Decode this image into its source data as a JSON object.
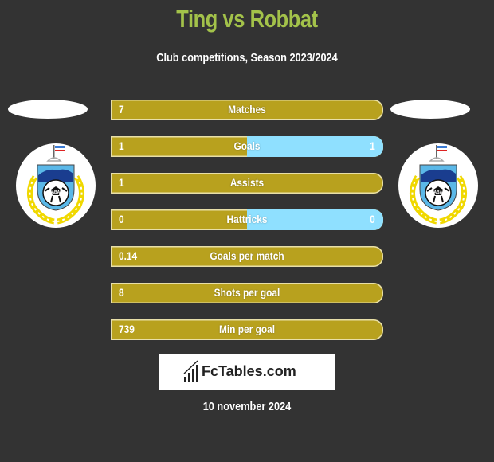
{
  "header": {
    "title": "Ting vs Robbat",
    "subtitle": "Club competitions, Season 2023/2024"
  },
  "colors": {
    "background": "#333333",
    "title": "#a3c24a",
    "left_bar": "#b8a11e",
    "right_bar": "#8fe0ff"
  },
  "players": {
    "left": {
      "name": "Ting",
      "club_badge": "sabah-fa-badge-icon"
    },
    "right": {
      "name": "Robbat",
      "club_badge": "sabah-fa-badge-icon"
    }
  },
  "stats": [
    {
      "label": "Matches",
      "left": "7",
      "right": "",
      "right_share": 0
    },
    {
      "label": "Goals",
      "left": "1",
      "right": "1",
      "right_share": 0.5
    },
    {
      "label": "Assists",
      "left": "1",
      "right": "",
      "right_share": 0
    },
    {
      "label": "Hattricks",
      "left": "0",
      "right": "0",
      "right_share": 0.5
    },
    {
      "label": "Goals per match",
      "left": "0.14",
      "right": "",
      "right_share": 0
    },
    {
      "label": "Shots per goal",
      "left": "8",
      "right": "",
      "right_share": 0
    },
    {
      "label": "Min per goal",
      "left": "739",
      "right": "",
      "right_share": 0
    }
  ],
  "footer": {
    "logo_text": "FcTables.com",
    "logo_icon": "bar-chart-icon",
    "date": "10 november 2024"
  }
}
